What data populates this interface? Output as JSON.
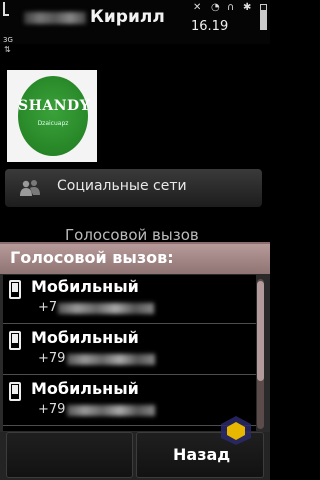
{
  "status": {
    "contact_name": "Кирилл",
    "time": "16.19",
    "network": "3G"
  },
  "contact": {
    "avatar_text": "SHANDY",
    "avatar_subtext": "Dzaicuapz",
    "social_label": "Социальные сети",
    "behind_label": "Голосовой вызов"
  },
  "dialog": {
    "title": "Голосовой вызов:",
    "items": [
      {
        "type": "Мобильный",
        "number": "+7"
      },
      {
        "type": "Мобильный",
        "number": "+79"
      },
      {
        "type": "Мобильный",
        "number": "+79"
      }
    ]
  },
  "softkeys": {
    "right": "Назад"
  },
  "colors": {
    "dialog_header": "#a88b8b",
    "avatar_green": "#2d8f2d"
  }
}
